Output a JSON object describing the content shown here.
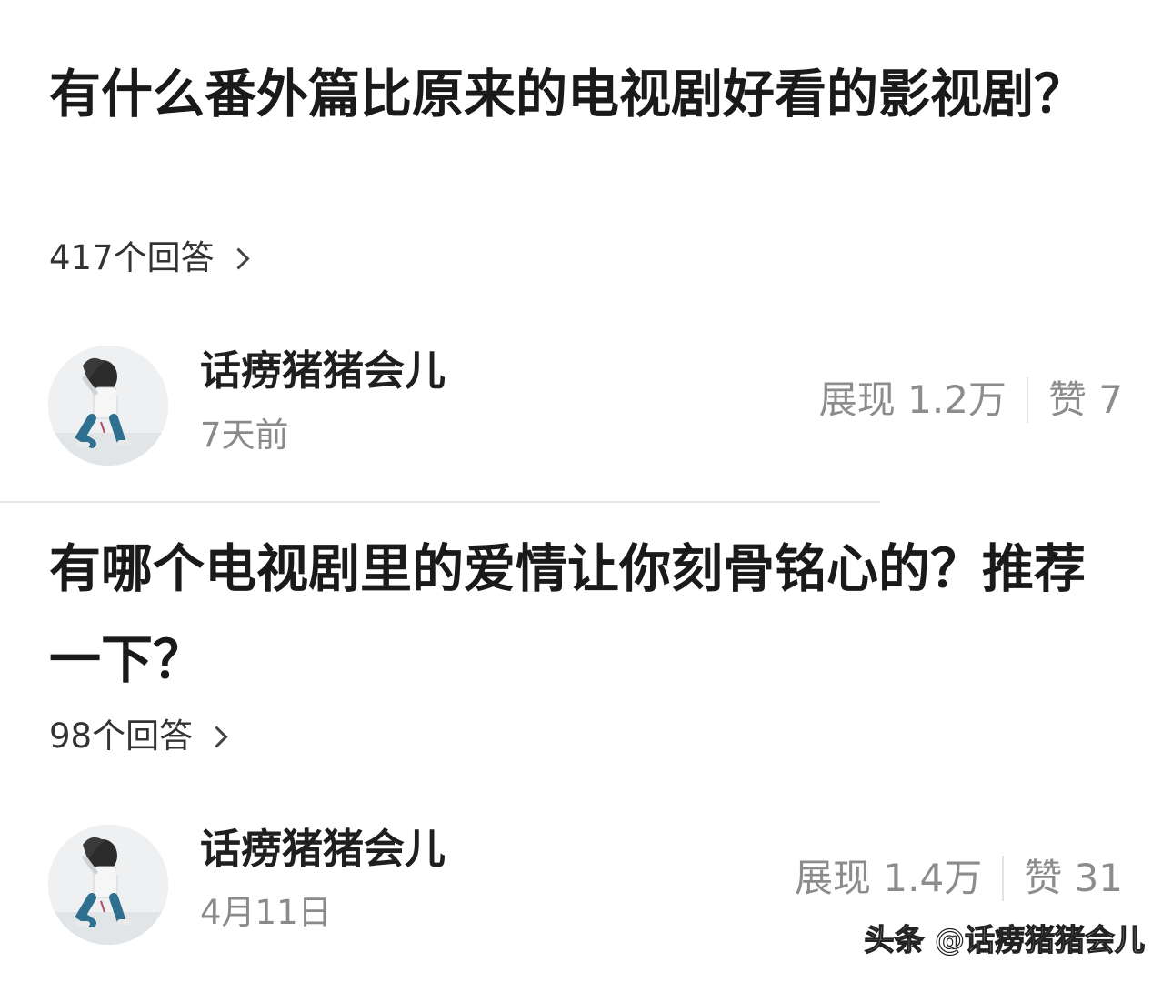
{
  "posts": [
    {
      "question": "有什么番外篇比原来的电视剧好看的影视剧？",
      "answers_count": "417个回答",
      "author": "话痨猪猪会儿",
      "time": "7天前",
      "views": "展现 1.2万",
      "likes": "赞 7"
    },
    {
      "question": "有哪个电视剧里的爱情让你刻骨铭心的？推荐一下？",
      "answers_count": "98个回答",
      "author": "话痨猪猪会儿",
      "time": "4月11日",
      "views": "展现 1.4万",
      "likes": "赞 31"
    }
  ],
  "watermark": "头条 @话痨猪猪会儿",
  "icons": {
    "chevron": "chevron-right-icon",
    "avatar": "avatar-photo"
  },
  "colors": {
    "title": "#1a1a1a",
    "meta": "#8a8a8a",
    "divider": "#e6e6e6"
  }
}
